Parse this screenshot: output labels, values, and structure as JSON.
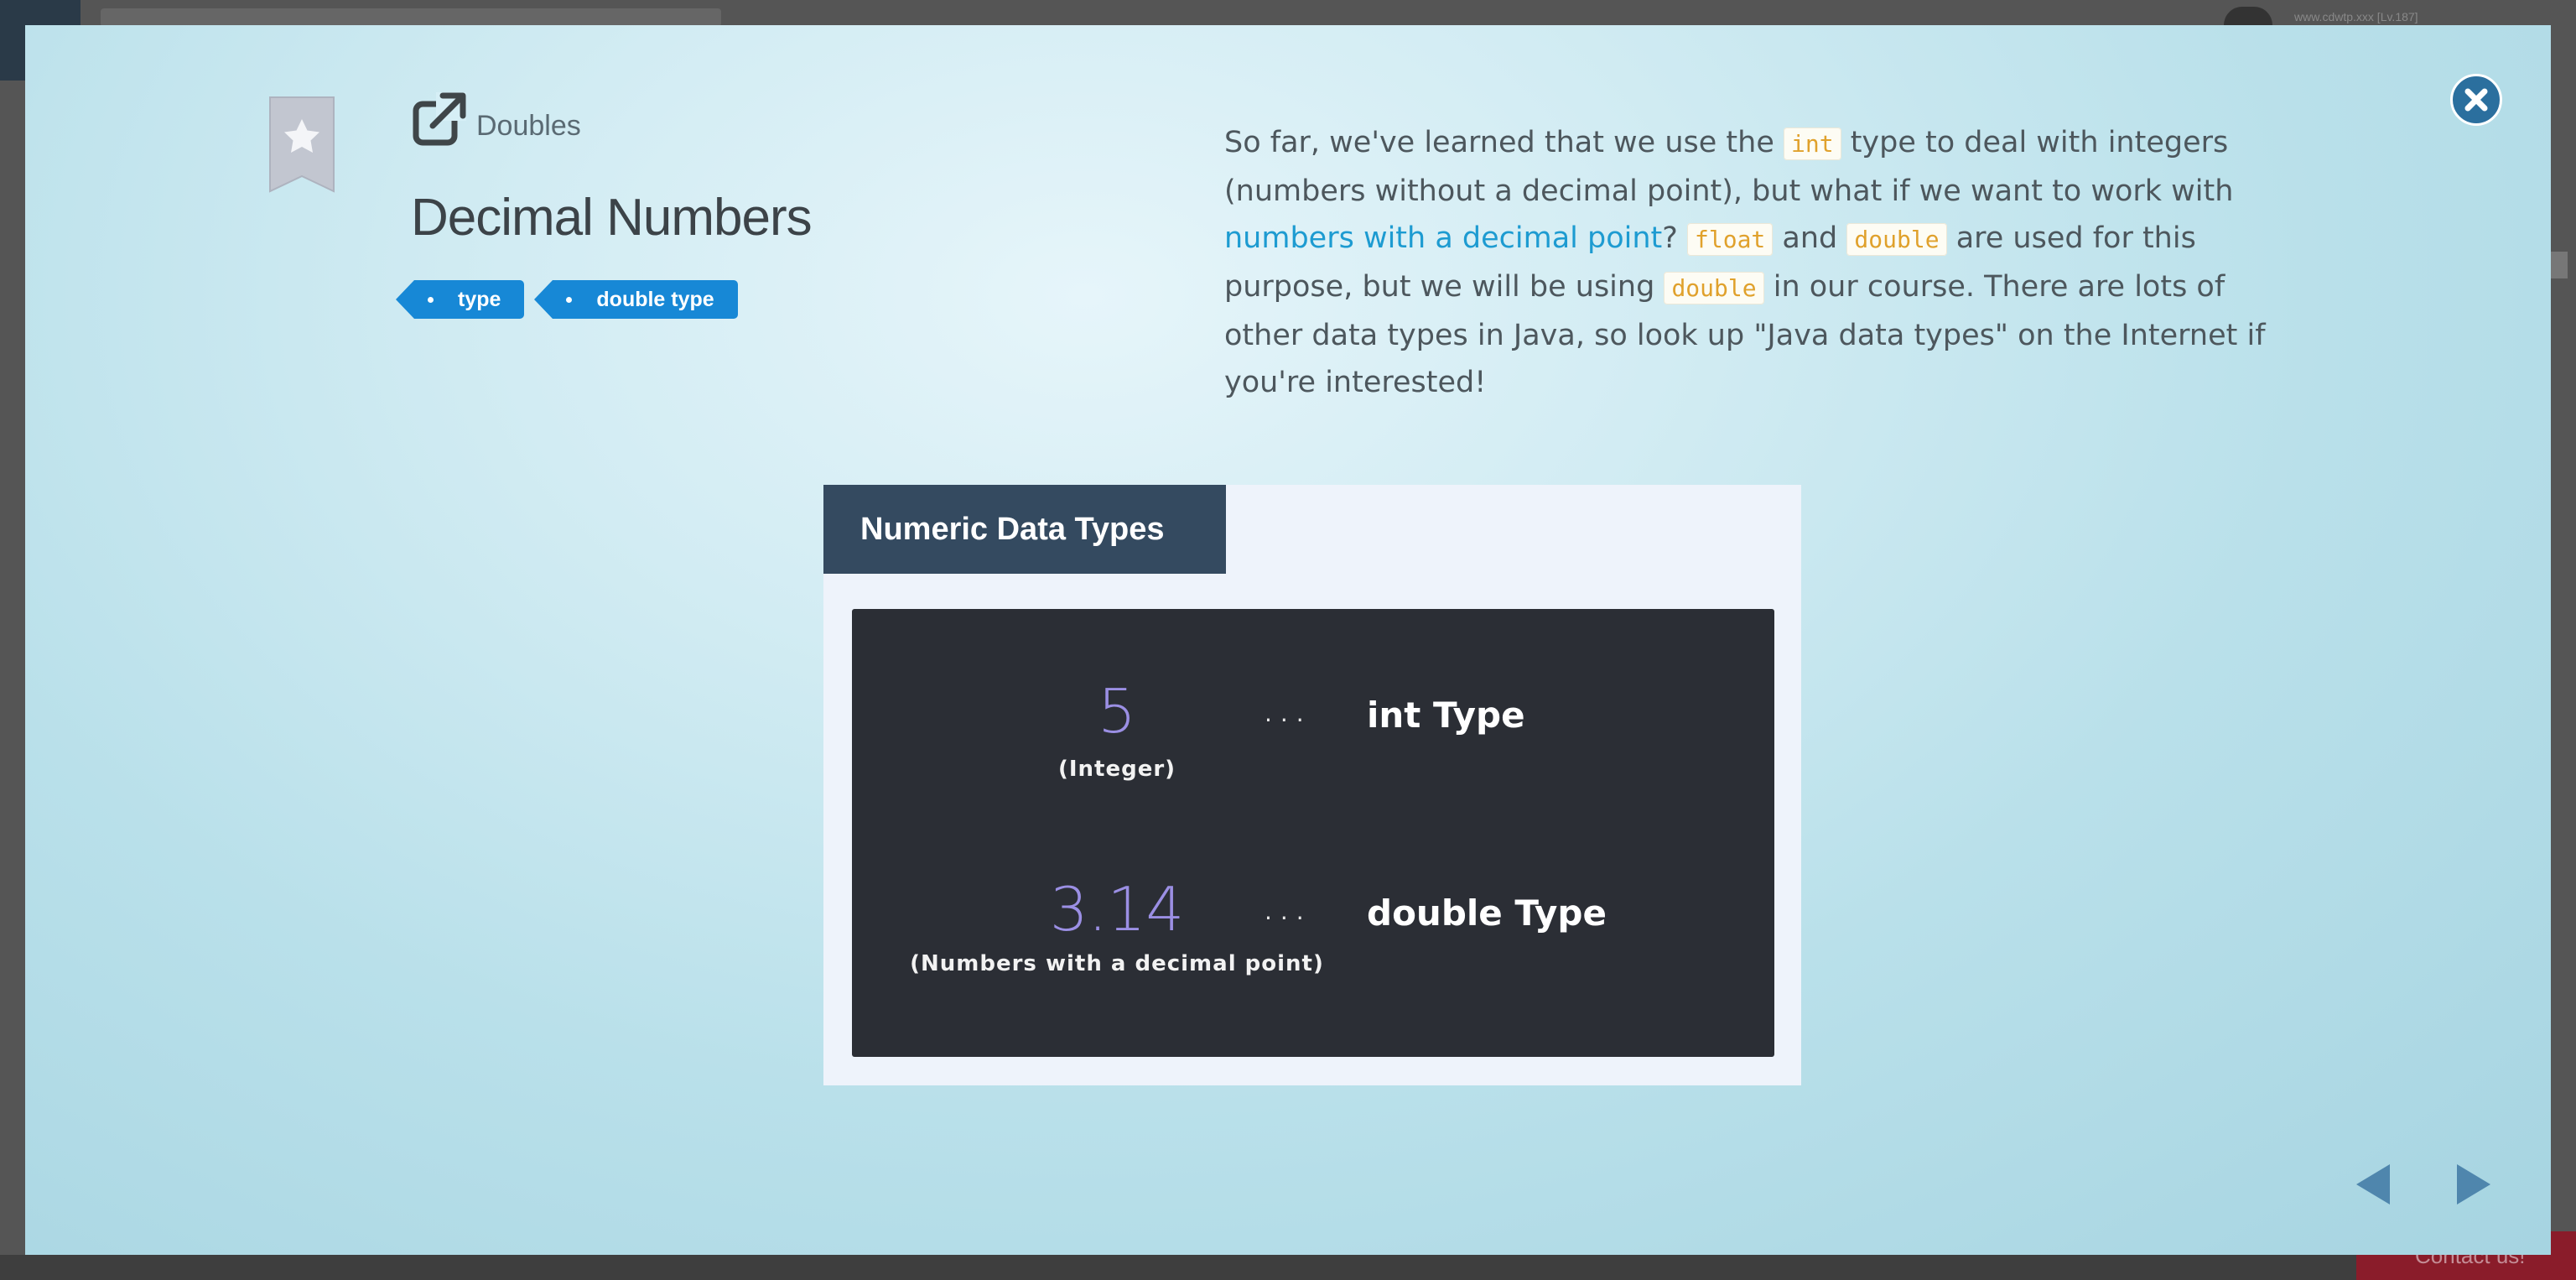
{
  "background": {
    "user_line": "www.cdwtp.xxx [Lv.187]",
    "contact_label": "Contact us!"
  },
  "lesson": {
    "breadcrumb": "Doubles",
    "title": "Decimal Numbers",
    "tags": [
      "type",
      "double type"
    ],
    "description": {
      "part1": "So far, we've learned that we use the ",
      "code_int": "int",
      "part2": " type to deal with integers (numbers without a decimal point), but what if we want to work with ",
      "link": "numbers with a decimal point",
      "part3": "? ",
      "code_float": "float",
      "part4": " and ",
      "code_double1": "double",
      "part5": " are used for this purpose, but we will be using ",
      "code_double2": "double",
      "part6": " in our course. There are lots of other data types in Java, so look up \"Java data types\" on the Internet if you're interested!"
    }
  },
  "slide": {
    "header": "Numeric Data Types",
    "rows": [
      {
        "number": "5",
        "caption": "(Integer)",
        "dots": "...",
        "type": "int Type"
      },
      {
        "number": "3.14",
        "caption": "(Numbers with a decimal point)",
        "dots": "...",
        "type": "double Type"
      }
    ]
  },
  "icons": {
    "close": "close-icon",
    "bookmark": "bookmark-star-icon",
    "external": "external-link-icon",
    "prev": "arrow-left-icon",
    "next": "arrow-right-icon"
  },
  "colors": {
    "accent_blue": "#1788d6",
    "close_button": "#2b6f9e",
    "slide_header": "#344a60",
    "code_text": "#e0a12c",
    "link": "#1d9bd1",
    "number_purple": "#9b8fe4"
  }
}
